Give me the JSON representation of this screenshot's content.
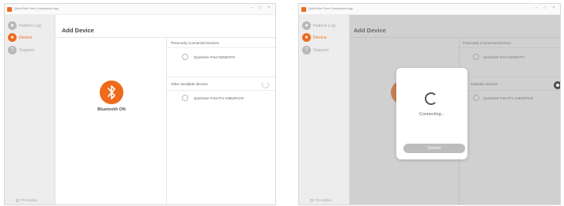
{
  "app": {
    "title": "QuickSee Free Companion App"
  },
  "window_controls": {
    "minimize": "–",
    "maximize": "□",
    "close": "×"
  },
  "sidebar": {
    "items": [
      {
        "label": "Patient Log",
        "icon": "person-icon"
      },
      {
        "label": "Device",
        "icon": "device-icon"
      },
      {
        "label": "Support",
        "icon": "question-icon"
      }
    ],
    "brand": {
      "prefix": "Plenoptika",
      "accent": ""
    }
  },
  "main": {
    "title": "Add Device",
    "bluetooth_status": "Bluetooth ON",
    "bluetooth_glyph": "✱",
    "previously_connected_header": "Previously Connected Devices",
    "previously_connected": [
      "QuickSee Free NZ55GFN"
    ],
    "other_header": "Other available devices",
    "other_header_partial": "available devices",
    "other_available": [
      "QuickSee Free Pro A0BUPCH0"
    ]
  },
  "modal": {
    "status": "Connecting...",
    "cancel_label": "Cancel"
  },
  "colors": {
    "accent": "#ee6a1c",
    "sidebar_bg": "#ededed",
    "overlay": "rgba(150,150,150,0.45)"
  }
}
